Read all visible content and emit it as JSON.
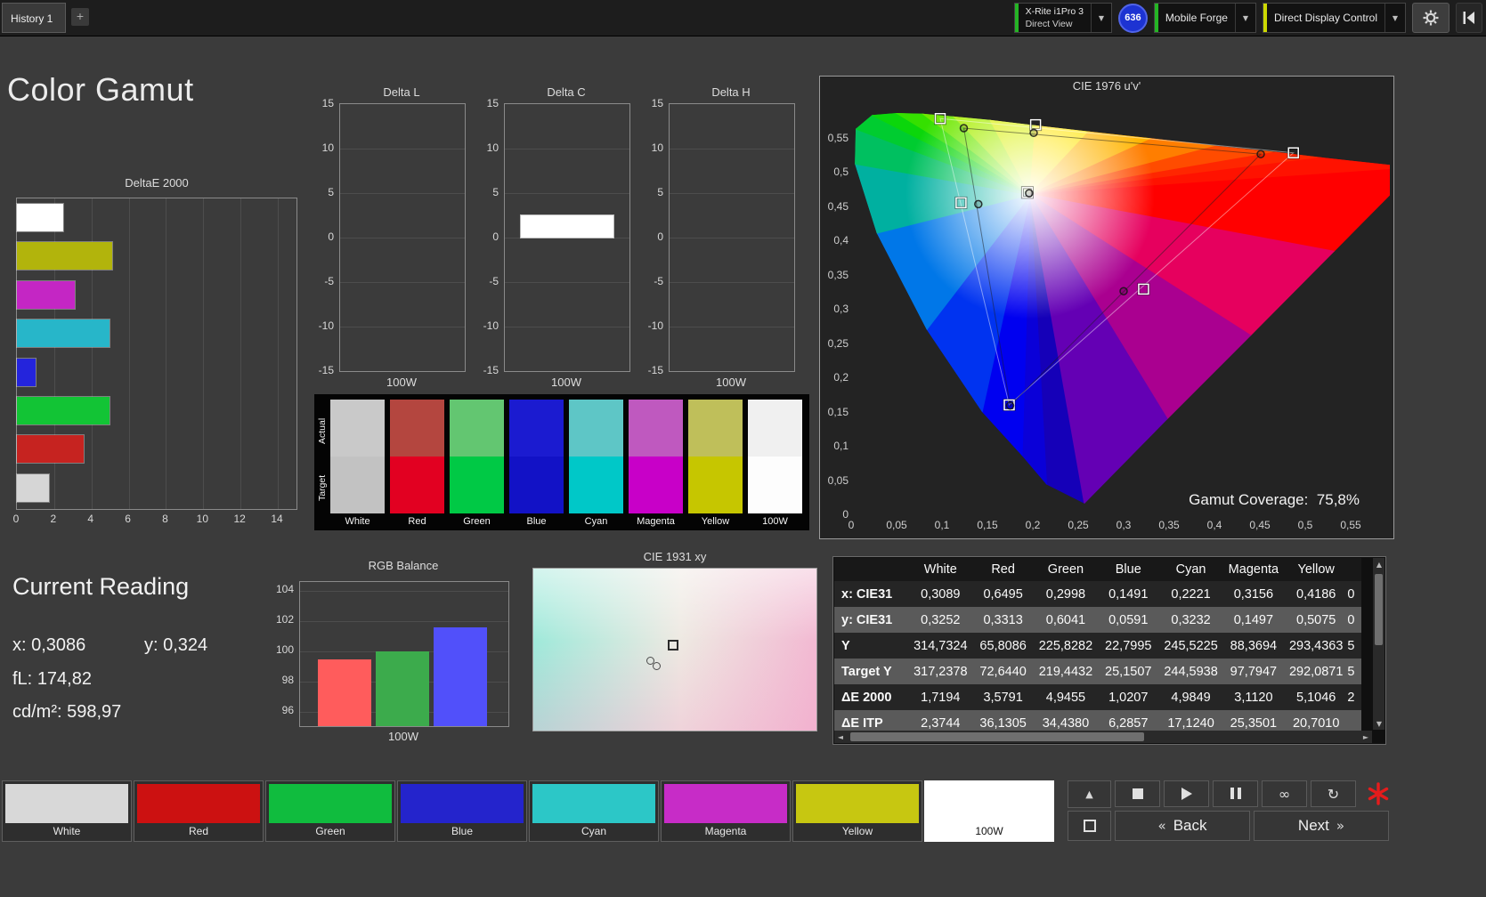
{
  "topbar": {
    "tab_label": "History 1",
    "add_tab_label": "+",
    "meter": {
      "line1": "X-Rite i1Pro 3",
      "line2": "Direct View",
      "accent": "#25b425"
    },
    "badge": "636",
    "source": {
      "label": "Mobile Forge",
      "accent": "#25b425"
    },
    "display_control": {
      "label": "Direct Display Control",
      "accent": "#ccd800"
    }
  },
  "page_title": "Color Gamut",
  "current_reading": {
    "title": "Current Reading",
    "x_label": "x:",
    "x_value": "0,3086",
    "y_label": "y:",
    "y_value": "0,324",
    "fl_label": "fL:",
    "fl_value": "174,82",
    "cd_label": "cd/m²:",
    "cd_value": "598,97"
  },
  "charts": {
    "deltae2000": {
      "type": "bar",
      "title": "DeltaE 2000",
      "xmax": 15,
      "xticks": [
        0,
        2,
        4,
        6,
        8,
        10,
        12,
        14
      ],
      "bars": [
        {
          "name": "100W",
          "value": 2.5,
          "color": "#ffffff"
        },
        {
          "name": "Yellow",
          "value": 5.1,
          "color": "#b2b40c"
        },
        {
          "name": "Magenta",
          "value": 3.11,
          "color": "#c426c4"
        },
        {
          "name": "Cyan",
          "value": 4.98,
          "color": "#27b6c9"
        },
        {
          "name": "Blue",
          "value": 1.02,
          "color": "#2424dc"
        },
        {
          "name": "Green",
          "value": 4.95,
          "color": "#12c435"
        },
        {
          "name": "Red",
          "value": 3.58,
          "color": "#c62320"
        },
        {
          "name": "White",
          "value": 1.72,
          "color": "#d6d6d6"
        }
      ]
    },
    "delta_charts": [
      {
        "title": "Delta L",
        "category": "100W",
        "value": 0,
        "ymin": -15,
        "ymax": 15,
        "yticks": [
          15,
          10,
          5,
          0,
          -5,
          -10,
          -15
        ]
      },
      {
        "title": "Delta C",
        "category": "100W",
        "value": 2.5,
        "ymin": -15,
        "ymax": 15,
        "yticks": [
          15,
          10,
          5,
          0,
          -5,
          -10,
          -15
        ]
      },
      {
        "title": "Delta H",
        "category": "100W",
        "value": 0,
        "ymin": -15,
        "ymax": 15,
        "yticks": [
          15,
          10,
          5,
          0,
          -5,
          -10,
          -15
        ]
      }
    ],
    "rgb_balance": {
      "type": "bar",
      "title": "RGB Balance",
      "category": "100W",
      "ymin": 96,
      "ymax": 104,
      "yticks": [
        104,
        102,
        100,
        98,
        96
      ],
      "bars": [
        {
          "name": "Red",
          "value": 99.5,
          "color": "#ff5c5c"
        },
        {
          "name": "Green",
          "value": 100.0,
          "color": "#3cab4c"
        },
        {
          "name": "Blue",
          "value": 101.6,
          "color": "#5150fa"
        }
      ]
    },
    "cie1976": {
      "title": "CIE 1976 u'v'",
      "coverage_label": "Gamut Coverage:",
      "coverage_value": "75,8%",
      "xticks": [
        "0",
        "0,05",
        "0,1",
        "0,15",
        "0,2",
        "0,25",
        "0,3",
        "0,35",
        "0,4",
        "0,45",
        "0,5",
        "0,55"
      ],
      "yticks": [
        "0,55",
        "0,5",
        "0,45",
        "0,4",
        "0,35",
        "0,3",
        "0,25",
        "0,2",
        "0,15",
        "0,1",
        "0,05",
        "0"
      ],
      "white_point": [
        0.197,
        0.468
      ],
      "targets": [
        [
          0.098,
          0.579
        ],
        [
          0.203,
          0.57
        ],
        [
          0.487,
          0.529
        ],
        [
          0.121,
          0.456
        ],
        [
          0.194,
          0.471
        ],
        [
          0.322,
          0.33
        ],
        [
          0.174,
          0.161
        ]
      ],
      "measurements": [
        [
          0.124,
          0.565
        ],
        [
          0.201,
          0.558
        ],
        [
          0.451,
          0.527
        ],
        [
          0.14,
          0.454
        ],
        [
          0.196,
          0.47
        ],
        [
          0.3,
          0.327
        ],
        [
          0.175,
          0.16
        ]
      ],
      "gamut_triangle_target": [
        2,
        0,
        6
      ],
      "gamut_triangle_measured": [
        2,
        0,
        6
      ],
      "locus": [
        {
          "u": 0.257,
          "v": 0.017,
          "c": "#1500b8"
        },
        {
          "u": 0.215,
          "v": 0.045,
          "c": "#0a00d8"
        },
        {
          "u": 0.188,
          "v": 0.087,
          "c": "#0000f0"
        },
        {
          "u": 0.144,
          "v": 0.151,
          "c": "#0033f0"
        },
        {
          "u": 0.083,
          "v": 0.271,
          "c": "#0077e8"
        },
        {
          "u": 0.028,
          "v": 0.412,
          "c": "#00b0a0"
        },
        {
          "u": 0.004,
          "v": 0.513,
          "c": "#00c060"
        },
        {
          "u": 0.005,
          "v": 0.564,
          "c": "#00cc30"
        },
        {
          "u": 0.023,
          "v": 0.584,
          "c": "#0bd60b"
        },
        {
          "u": 0.05,
          "v": 0.587,
          "c": "#35e000"
        },
        {
          "u": 0.079,
          "v": 0.586,
          "c": "#6fe800"
        },
        {
          "u": 0.113,
          "v": 0.582,
          "c": "#a8ee00"
        },
        {
          "u": 0.153,
          "v": 0.577,
          "c": "#d8f000"
        },
        {
          "u": 0.203,
          "v": 0.569,
          "c": "#ffe400"
        },
        {
          "u": 0.262,
          "v": 0.56,
          "c": "#ffb400"
        },
        {
          "u": 0.332,
          "v": 0.55,
          "c": "#ff7e00"
        },
        {
          "u": 0.403,
          "v": 0.539,
          "c": "#ff4c00"
        },
        {
          "u": 0.469,
          "v": 0.53,
          "c": "#ff2600"
        },
        {
          "u": 0.52,
          "v": 0.522,
          "c": "#ff1200"
        },
        {
          "u": 0.623,
          "v": 0.507,
          "c": "#ff0000"
        },
        {
          "u": 0.532,
          "v": 0.385,
          "c": "#e6005e"
        },
        {
          "u": 0.44,
          "v": 0.262,
          "c": "#aa0090"
        },
        {
          "u": 0.348,
          "v": 0.14,
          "c": "#6400b4"
        }
      ]
    },
    "cie1931": {
      "title": "CIE 1931 xy",
      "target": [
        0.49,
        0.47
      ],
      "measurements": [
        [
          0.41,
          0.56
        ],
        [
          0.43,
          0.59
        ]
      ]
    }
  },
  "swatch_panel": {
    "row_labels": [
      "Actual",
      "Target"
    ],
    "swatches": [
      {
        "label": "White",
        "actual": "#c9c9c9",
        "target": "#c2c2c2"
      },
      {
        "label": "Red",
        "actual": "#b4463f",
        "target": "#e20021"
      },
      {
        "label": "Green",
        "actual": "#63c671",
        "target": "#00c945"
      },
      {
        "label": "Blue",
        "actual": "#1b1bd0",
        "target": "#1212c6"
      },
      {
        "label": "Cyan",
        "actual": "#5ec6c6",
        "target": "#00c8c8"
      },
      {
        "label": "Magenta",
        "actual": "#bf59bf",
        "target": "#c800c8"
      },
      {
        "label": "Yellow",
        "actual": "#bfbf5a",
        "target": "#c6c600"
      },
      {
        "label": "100W",
        "actual": "#f0f0f0",
        "target": "#fdfdfd"
      }
    ]
  },
  "table": {
    "columns": [
      "",
      "White",
      "Red",
      "Green",
      "Blue",
      "Cyan",
      "Magenta",
      "Yellow"
    ],
    "rows": [
      {
        "label": "x: CIE31",
        "values": [
          "0,3089",
          "0,6495",
          "0,2998",
          "0,1491",
          "0,2221",
          "0,3156",
          "0,4186"
        ],
        "partial": "0"
      },
      {
        "label": "y: CIE31",
        "values": [
          "0,3252",
          "0,3313",
          "0,6041",
          "0,0591",
          "0,3232",
          "0,1497",
          "0,5075"
        ],
        "partial": "0"
      },
      {
        "label": "Y",
        "values": [
          "314,7324",
          "65,8086",
          "225,8282",
          "22,7995",
          "245,5225",
          "88,3694",
          "293,4363"
        ],
        "partial": "5"
      },
      {
        "label": "Target Y",
        "values": [
          "317,2378",
          "72,6440",
          "219,4432",
          "25,1507",
          "244,5938",
          "97,7947",
          "292,0871"
        ],
        "partial": "5"
      },
      {
        "label": "ΔE 2000",
        "values": [
          "1,7194",
          "3,5791",
          "4,9455",
          "1,0207",
          "4,9849",
          "3,1120",
          "5,1046"
        ],
        "partial": "2"
      },
      {
        "label": "ΔE ITP",
        "values": [
          "2,3744",
          "36,1305",
          "34,4380",
          "6,2857",
          "17,1240",
          "25,3501",
          "20,7010"
        ],
        "partial": ""
      }
    ]
  },
  "bottom_bar": {
    "patches": [
      {
        "label": "White",
        "color": "#d8d8d8",
        "selected": false
      },
      {
        "label": "Red",
        "color": "#cc1111",
        "selected": false
      },
      {
        "label": "Green",
        "color": "#10bc3e",
        "selected": false
      },
      {
        "label": "Blue",
        "color": "#2424cc",
        "selected": false
      },
      {
        "label": "Cyan",
        "color": "#2cc7c7",
        "selected": false
      },
      {
        "label": "Magenta",
        "color": "#c72cc7",
        "selected": false
      },
      {
        "label": "Yellow",
        "color": "#c7c711",
        "selected": false
      },
      {
        "label": "100W",
        "color": "#ffffff",
        "selected": true
      }
    ],
    "back_label": "Back",
    "next_label": "Next",
    "back_chevron": "«",
    "next_chevron": "»"
  }
}
